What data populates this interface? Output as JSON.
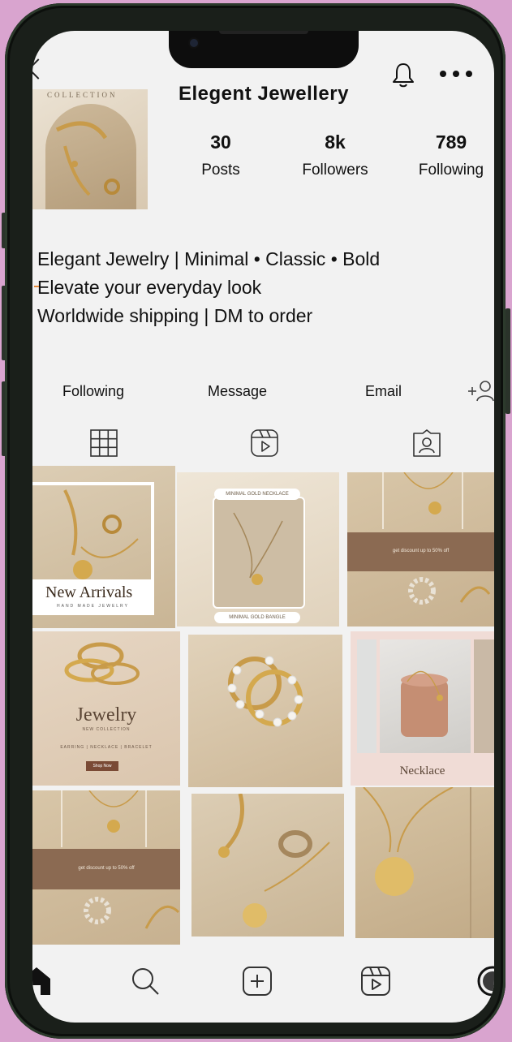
{
  "profile": {
    "username": "Elegent  Jewellery",
    "avatar_caption": "COLLECTION",
    "stats": [
      {
        "value": "30",
        "label": "Posts"
      },
      {
        "value": "8k",
        "label": "Followers"
      },
      {
        "value": "789",
        "label": "Following"
      }
    ],
    "bio": [
      "Elegant Jewelry | Minimal • Classic • Bold",
      " Elevate your everyday look",
      " Worldwide shipping | DM to order"
    ]
  },
  "actions": {
    "following": "Following",
    "message": "Message",
    "email": "Email"
  },
  "posts": {
    "p1": {
      "title": "New Arrivals",
      "subtitle": "HAND MADE JEWELRY"
    },
    "p2": {
      "top": "MINIMAL GOLD NECKLACE",
      "bottom": "MINIMAL GOLD BANGLE"
    },
    "p3": {
      "banner": "get discount up to 50% off"
    },
    "p4": {
      "title": "Jewelry",
      "subtitle": "NEW COLLECTION",
      "tags": "EARRING | NECKLACE | BRACELET",
      "button": "Shop Now"
    },
    "p6": {
      "title": "Necklace"
    },
    "p7": {
      "banner": "get discount up to 50% off"
    }
  },
  "icons": {
    "header": [
      "chevron-left-icon",
      "bell-icon",
      "more-icon"
    ],
    "tabs": [
      "grid-icon",
      "reels-icon",
      "tagged-icon"
    ],
    "nav": [
      "home-icon",
      "search-icon",
      "create-icon",
      "reels-icon",
      "profile-icon"
    ]
  },
  "colors": {
    "background": "#d9a4cf",
    "screen": "#f2f2f2",
    "banner_brown": "#8b6a52",
    "gold": "#c89b4a"
  }
}
